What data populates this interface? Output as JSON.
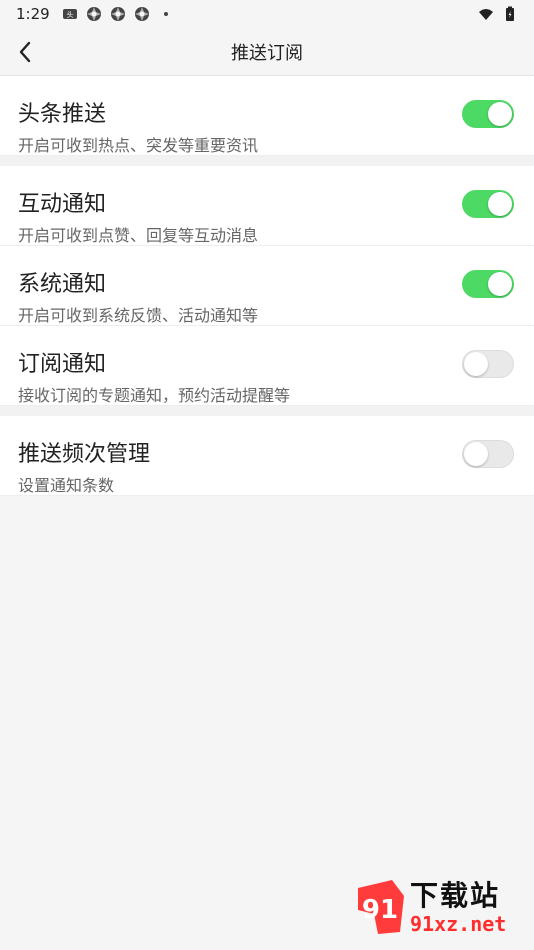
{
  "statusbar": {
    "time": "1:29",
    "left_icons": [
      "news-app-icon",
      "aperture-icon",
      "aperture-icon",
      "aperture-icon",
      "dot-icon"
    ],
    "right_icons": [
      "wifi-icon",
      "battery-icon"
    ]
  },
  "header": {
    "title": "推送订阅",
    "back_icon": "chevron-left-icon"
  },
  "rows": [
    {
      "label": "头条推送",
      "desc": "开启可收到热点、突发等重要资讯",
      "on": true
    },
    {
      "label": "互动通知",
      "desc": "开启可收到点赞、回复等互动消息",
      "on": true
    },
    {
      "label": "系统通知",
      "desc": "开启可收到系统反馈、活动通知等",
      "on": true
    },
    {
      "label": "订阅通知",
      "desc": "接收订阅的专题通知，预约活动提醒等",
      "on": false
    },
    {
      "label": "推送频次管理",
      "desc": "设置通知条数",
      "on": false
    }
  ],
  "watermark": {
    "brand": "下载站",
    "site": "91xz.net",
    "logo_text": "91"
  },
  "colors": {
    "toggle_on": "#4cd964",
    "toggle_off": "#e9e9e9",
    "background": "#f5f5f5"
  }
}
